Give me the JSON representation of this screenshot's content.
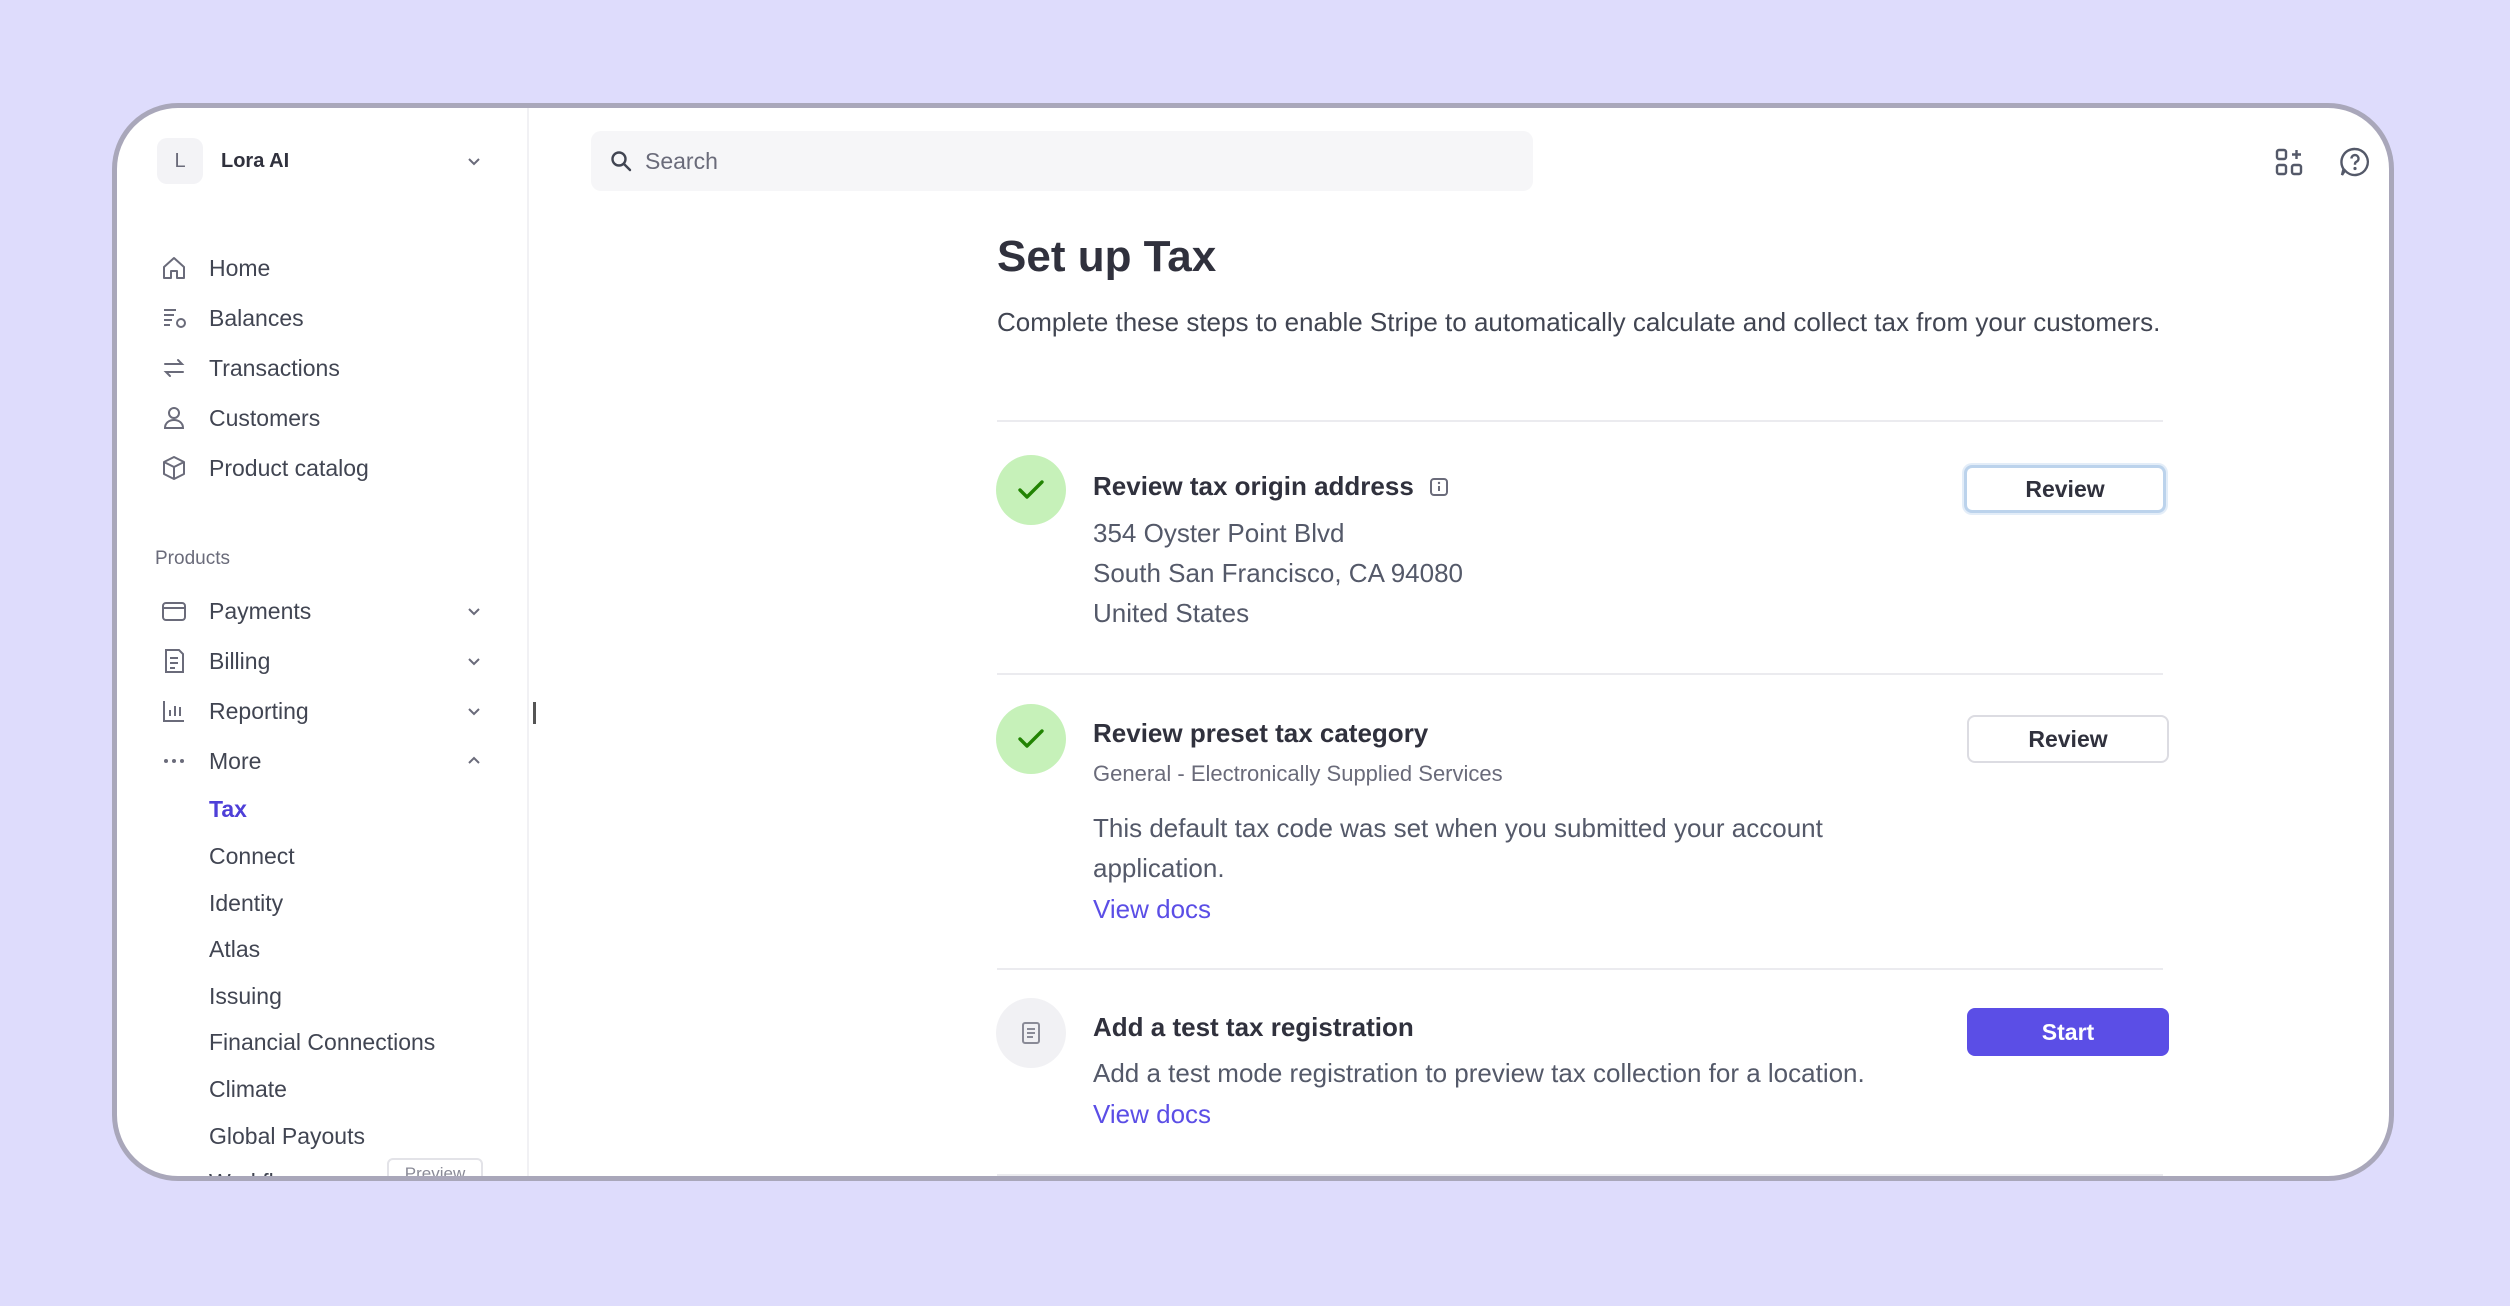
{
  "account": {
    "initial": "L",
    "name": "Lora AI"
  },
  "nav": {
    "primary": [
      {
        "label": "Home",
        "icon": "home-icon"
      },
      {
        "label": "Balances",
        "icon": "balances-icon"
      },
      {
        "label": "Transactions",
        "icon": "transactions-icon"
      },
      {
        "label": "Customers",
        "icon": "customers-icon"
      },
      {
        "label": "Product catalog",
        "icon": "product-catalog-icon"
      }
    ],
    "products_label": "Products",
    "products": [
      {
        "label": "Payments",
        "icon": "payments-icon"
      },
      {
        "label": "Billing",
        "icon": "billing-icon"
      },
      {
        "label": "Reporting",
        "icon": "reporting-icon"
      },
      {
        "label": "More",
        "icon": "more-icon"
      }
    ],
    "more_items": [
      {
        "label": "Tax",
        "active": true
      },
      {
        "label": "Connect"
      },
      {
        "label": "Identity"
      },
      {
        "label": "Atlas"
      },
      {
        "label": "Issuing"
      },
      {
        "label": "Financial Connections"
      },
      {
        "label": "Climate"
      },
      {
        "label": "Global Payouts"
      },
      {
        "label": "Workflows"
      }
    ],
    "preview_badge": "Preview"
  },
  "search": {
    "placeholder": "Search"
  },
  "main": {
    "title": "Set up Tax",
    "description": "Complete these steps to enable Stripe to automatically calculate and collect tax from your customers.",
    "steps": [
      {
        "title": "Review tax origin address",
        "lines": [
          "354 Oyster Point Blvd",
          "South San Francisco, CA 94080",
          "United States"
        ],
        "button": "Review",
        "status": "done"
      },
      {
        "title": "Review preset tax category",
        "subtitle": "General - Electronically Supplied Services",
        "description_line1": "This default tax code was set when you submitted your account",
        "description_line2": "application.",
        "link": "View docs",
        "button": "Review",
        "status": "done"
      },
      {
        "title": "Add a test tax registration",
        "description": "Add a test mode registration to preview tax collection for a location.",
        "link": "View docs",
        "button": "Start",
        "status": "pending"
      }
    ]
  },
  "colors": {
    "accent": "#5b4ee6",
    "success_bg": "#c6f1b9",
    "success_check": "#228403",
    "background": "#dedcfc"
  }
}
